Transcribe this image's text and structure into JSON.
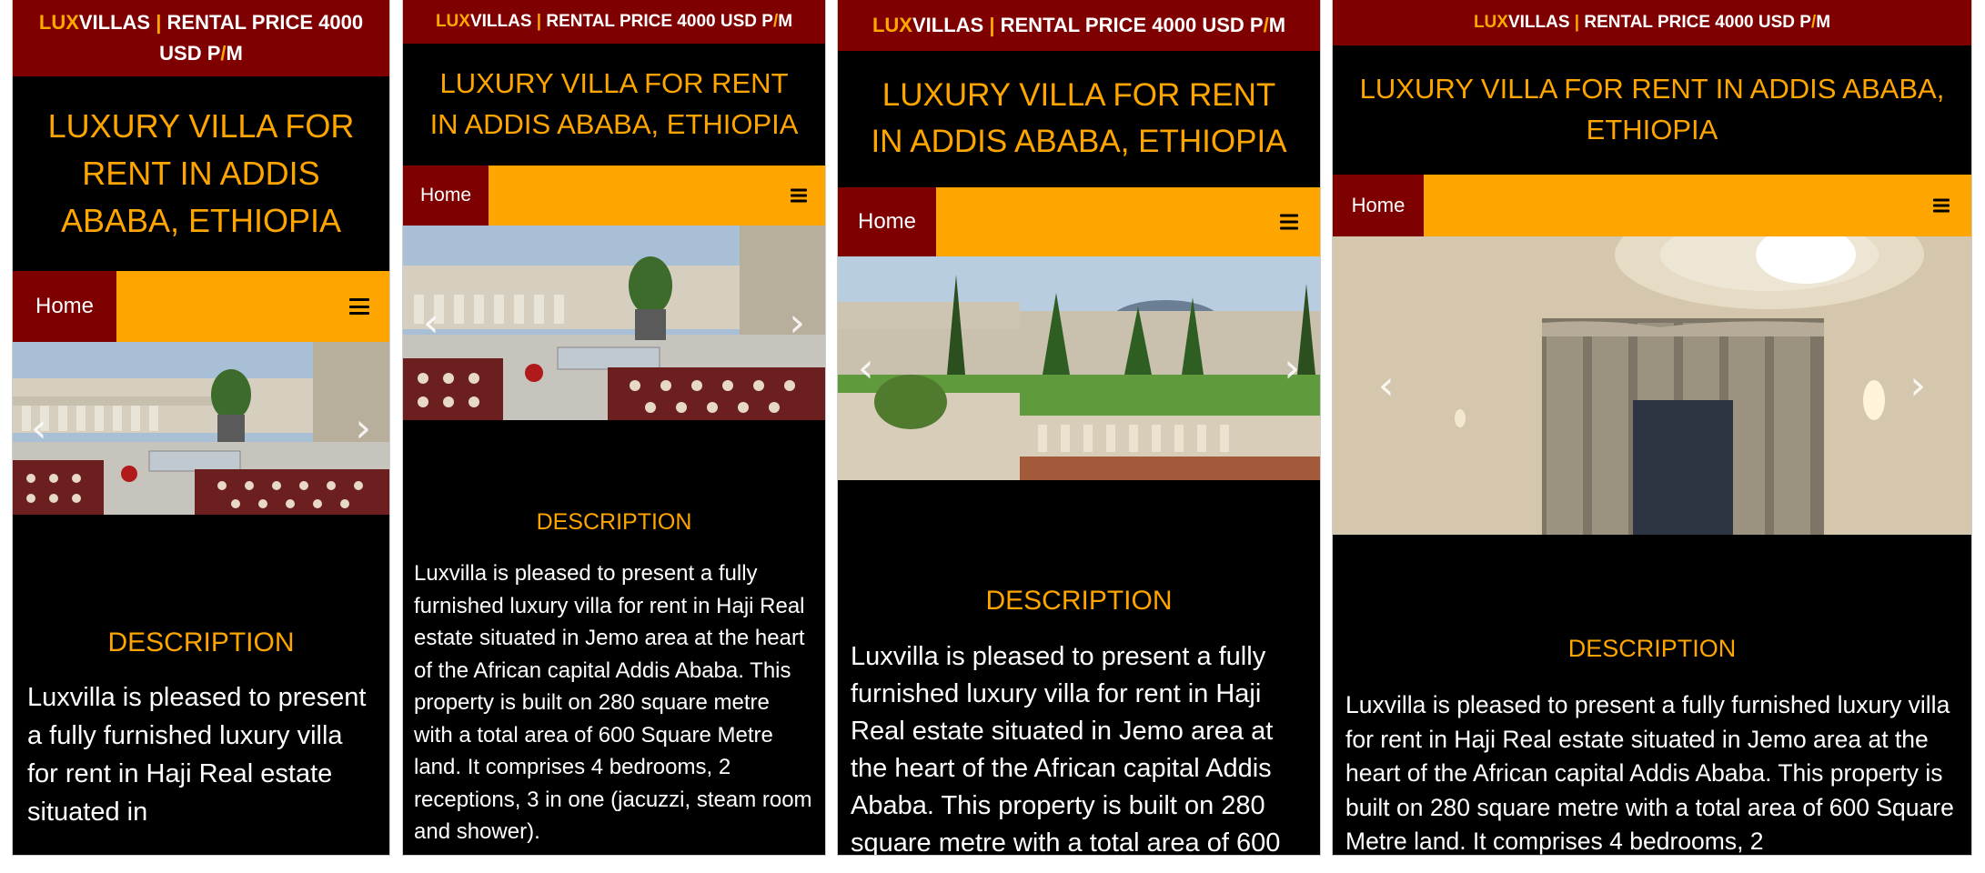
{
  "brand": {
    "lux": "LUX",
    "villas": "VILLAS",
    "separator": "|"
  },
  "price": {
    "prefix": "RENTAL PRICE 4000 USD P",
    "slash": "/",
    "suffix": "M"
  },
  "title": "LUXURY VILLA FOR RENT IN ADDIS ABABA, ETHIOPIA",
  "nav": {
    "home": "Home",
    "menu_icon": "hamburger-menu-icon"
  },
  "carousel": {
    "prev_icon": "chevron-left-icon",
    "next_icon": "chevron-right-icon",
    "prev_glyph": "‹",
    "next_glyph": "›"
  },
  "description": {
    "heading": "DESCRIPTION",
    "p1_full": "Luxvilla is pleased to present a fully furnished luxury villa for rent in Haji Real estate situated in Jemo area at the heart of the African capital Addis Ababa. This property is built on 280 square metre with a total area of 600 Square Metre land. It comprises 4 bedrooms, 2 receptions, 3 in one (jacuzzi, steam room and shower)."
  },
  "panels": [
    {
      "name": "mobile-small",
      "description_text": "Luxvilla is pleased to present a fully furnished luxury villa for rent in Haji Real estate situated in"
    },
    {
      "name": "mobile-medium",
      "description_text": "Luxvilla is pleased to present a fully furnished luxury villa for rent in Haji Real estate situated in Jemo area at the heart of the African capital Addis Ababa. This property is built on 280 square metre with a total area of 600 Square Metre land. It comprises 4 bedrooms, 2 receptions, 3 in one (jacuzzi, steam room and shower)."
    },
    {
      "name": "mobile-large",
      "description_text": "Luxvilla is pleased to present a fully furnished luxury villa for rent in Haji Real estate situated in Jemo area at the heart of the African capital Addis Ababa. This property is built on 280 square metre with a total area of 600"
    },
    {
      "name": "tablet",
      "description_text": "Luxvilla is pleased to present a fully furnished luxury villa for rent in Haji Real estate situated in Jemo area at the heart of the African capital Addis Ababa. This property is built on 280 square metre with a total area of 600 Square Metre land. It comprises 4 bedrooms, 2"
    }
  ],
  "colors": {
    "topbar": "#7f0000",
    "accent": "#ffa500",
    "background": "#000000",
    "home": "#7f0000"
  }
}
